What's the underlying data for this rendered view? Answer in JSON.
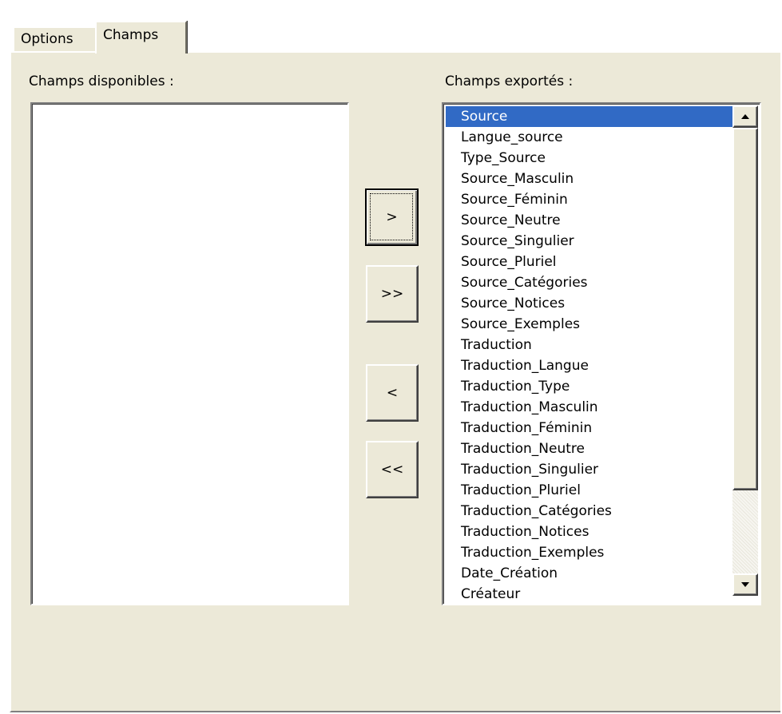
{
  "tabs": [
    {
      "label": "Options",
      "active": false
    },
    {
      "label": "Champs",
      "active": true
    }
  ],
  "available_fields": {
    "label": "Champs disponibles :",
    "items": []
  },
  "exported_fields": {
    "label": "Champs exportés :",
    "selected": "Source",
    "items": [
      "Source",
      "Langue_source",
      "Type_Source",
      "Source_Masculin",
      "Source_Féminin",
      "Source_Neutre",
      "Source_Singulier",
      "Source_Pluriel",
      "Source_Catégories",
      "Source_Notices",
      "Source_Exemples",
      "Traduction",
      "Traduction_Langue",
      "Traduction_Type",
      "Traduction_Masculin",
      "Traduction_Féminin",
      "Traduction_Neutre",
      "Traduction_Singulier",
      "Traduction_Pluriel",
      "Traduction_Catégories",
      "Traduction_Notices",
      "Traduction_Exemples",
      "Date_Création",
      "Créateur"
    ]
  },
  "buttons": {
    "add_one": ">",
    "add_all": ">>",
    "remove_one": "<",
    "remove_all": "<<"
  },
  "colors": {
    "panel": "#ece9d8",
    "selection": "#316ac5"
  }
}
